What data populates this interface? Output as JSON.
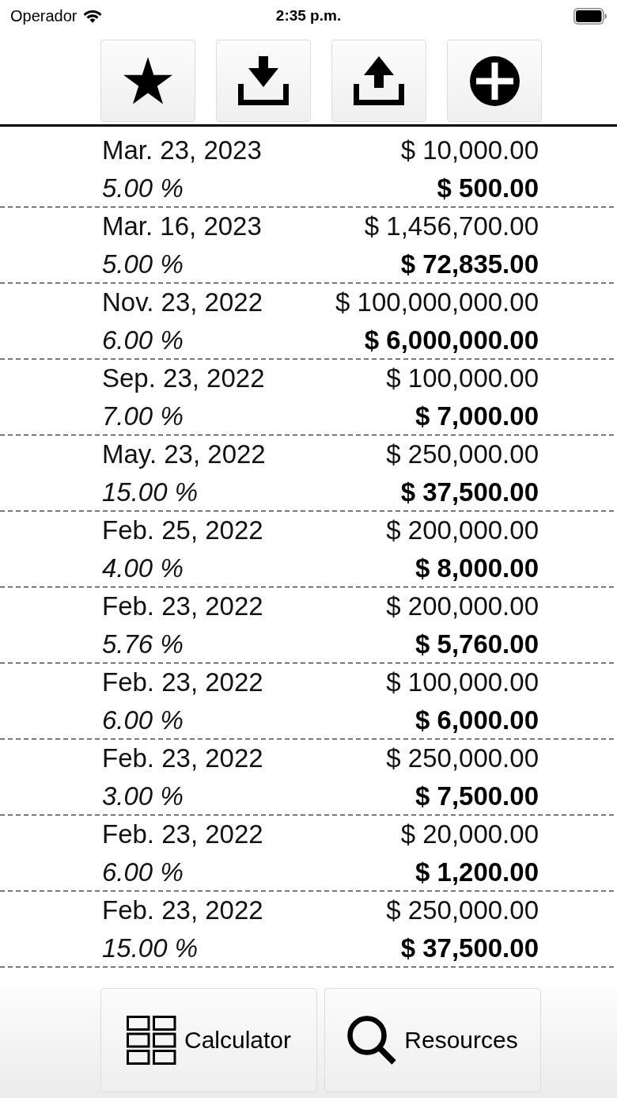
{
  "status_bar": {
    "carrier": "Operador",
    "time": "2:35 p.m."
  },
  "toolbar": {
    "buttons": [
      {
        "kind": "star"
      },
      {
        "kind": "download"
      },
      {
        "kind": "upload"
      },
      {
        "kind": "add"
      }
    ]
  },
  "entries": [
    {
      "date": "Mar. 23, 2023",
      "amount": "$ 10,000.00",
      "rate": "5.00 %",
      "interest": "$ 500.00"
    },
    {
      "date": "Mar. 16, 2023",
      "amount": "$ 1,456,700.00",
      "rate": "5.00 %",
      "interest": "$ 72,835.00"
    },
    {
      "date": "Nov. 23, 2022",
      "amount": "$ 100,000,000.00",
      "rate": "6.00 %",
      "interest": "$ 6,000,000.00"
    },
    {
      "date": "Sep. 23, 2022",
      "amount": "$ 100,000.00",
      "rate": "7.00 %",
      "interest": "$ 7,000.00"
    },
    {
      "date": "May. 23, 2022",
      "amount": "$ 250,000.00",
      "rate": "15.00 %",
      "interest": "$ 37,500.00"
    },
    {
      "date": "Feb. 25, 2022",
      "amount": "$ 200,000.00",
      "rate": "4.00 %",
      "interest": "$ 8,000.00"
    },
    {
      "date": "Feb. 23, 2022",
      "amount": "$ 200,000.00",
      "rate": "5.76 %",
      "interest": "$ 5,760.00"
    },
    {
      "date": "Feb. 23, 2022",
      "amount": "$ 100,000.00",
      "rate": "6.00 %",
      "interest": "$ 6,000.00"
    },
    {
      "date": "Feb. 23, 2022",
      "amount": "$ 250,000.00",
      "rate": "3.00 %",
      "interest": "$ 7,500.00"
    },
    {
      "date": "Feb. 23, 2022",
      "amount": "$ 20,000.00",
      "rate": "6.00 %",
      "interest": "$ 1,200.00"
    },
    {
      "date": "Feb. 23, 2022",
      "amount": "$ 250,000.00",
      "rate": "15.00 %",
      "interest": "$ 37,500.00"
    }
  ],
  "tab_bar": {
    "items": [
      {
        "kind": "calculator",
        "label": "Calculator"
      },
      {
        "kind": "search",
        "label": "Resources"
      }
    ]
  }
}
